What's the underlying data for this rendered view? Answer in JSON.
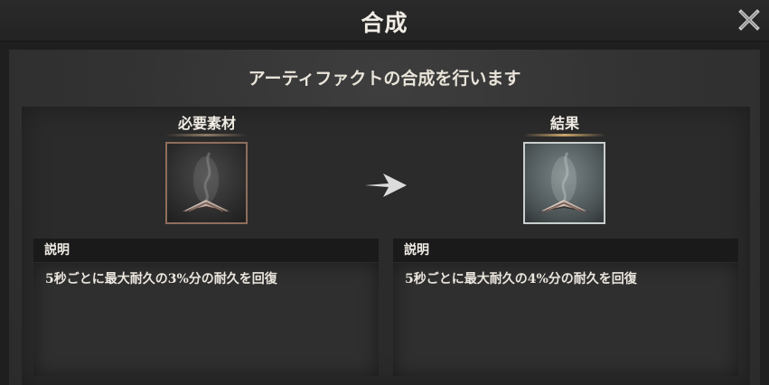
{
  "window": {
    "title": "合成"
  },
  "subtitle": "アーティファクトの合成を行います",
  "materials": {
    "label": "必要素材",
    "icon": "open-book-icon"
  },
  "result": {
    "label": "結果",
    "icon": "open-book-icon"
  },
  "arrow_icon": "arrow-right-icon",
  "close_icon": "close-icon",
  "descriptions": {
    "left": {
      "heading": "説明",
      "text": "5秒ごとに最大耐久の3%分の耐久を回復"
    },
    "right": {
      "heading": "説明",
      "text": "5秒ごとに最大耐久の4%分の耐久を回復"
    }
  },
  "colors": {
    "accent": "#c9a56a",
    "frame_required": "#8e6e5c",
    "frame_result": "#c9cfcc"
  }
}
